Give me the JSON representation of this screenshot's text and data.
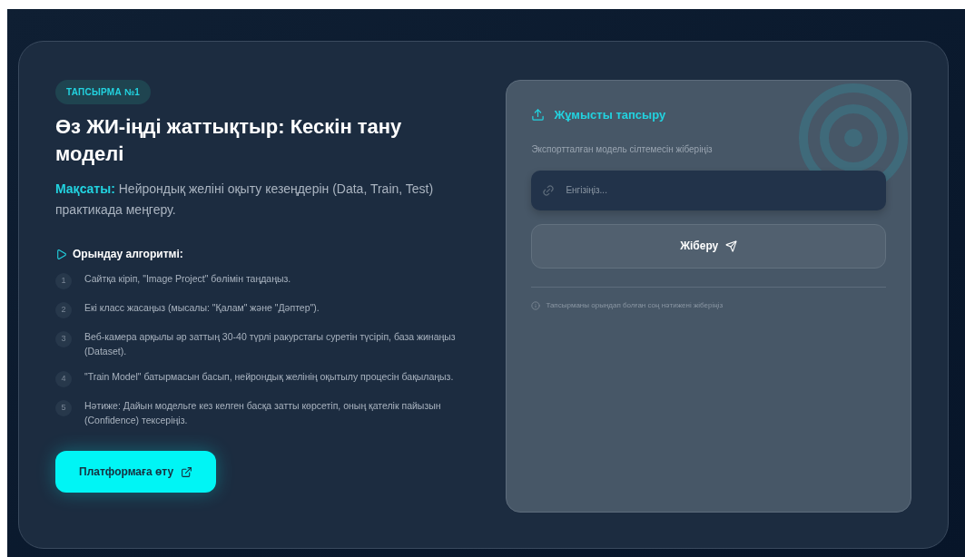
{
  "task": {
    "badge": "ТАПСЫРМА №1",
    "title": "Өз ЖИ-іңді жаттықтыр: Кескін тану моделі",
    "goal": "**Мақсаты:** Нейрондық желіні оқыту кезеңдерін (Data, Train, Test) практикада меңгеру.",
    "algorithm_title": "Орындау алгоритмі:",
    "steps": [
      {
        "number": "1",
        "text": "Сайтқа кіріп, \"Image Project\" бөлімін таңдаңыз."
      },
      {
        "number": "2",
        "text": "Екі класс жасаңыз (мысалы: \"Қалам\" және \"Дәптер\")."
      },
      {
        "number": "3",
        "text": "Веб-камера арқылы әр заттың 30-40 түрлі ракурстағы суретін түсіріп, база жинаңыз (Dataset)."
      },
      {
        "number": "4",
        "text": "\"Train Model\" батырмасын басып, нейрондық желінің оқытылу процесін бақылаңыз."
      },
      {
        "number": "5",
        "text": "Нәтиже: Дайын модельге кез келген басқа затты көрсетіп, оның қателік пайызын (Confidence) тексеріңіз."
      }
    ],
    "platform_button": "Платформаға өту"
  },
  "submission": {
    "title": "Жұмысты тапсыру",
    "label": "Экспортталған модель сілтемесін жіберіңіз",
    "placeholder": "Енгізіңіз...",
    "button": "Жіберу",
    "note": "Тапсырманы орындап болған соң нәтижені жіберіңіз"
  }
}
